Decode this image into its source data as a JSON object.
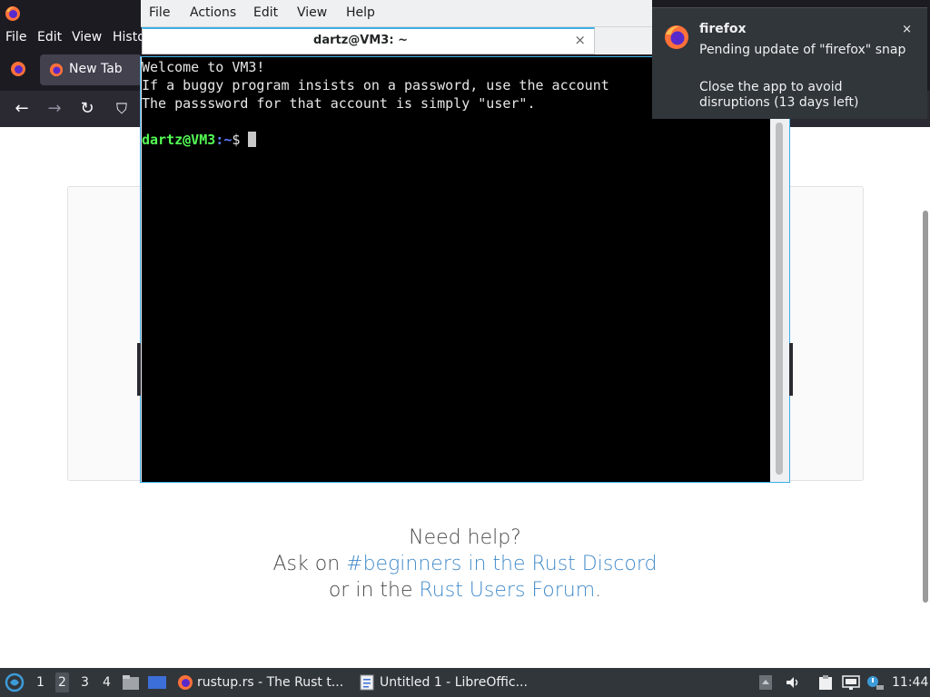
{
  "firefox": {
    "menu": [
      "File",
      "Edit",
      "View",
      "Histo"
    ],
    "tab_label": "New Tab",
    "help": {
      "line1": "Need help?",
      "line2_prefix": "Ask on ",
      "line2_link": "#beginners in the Rust Discord",
      "line3_prefix": "or in the ",
      "line3_link": "Rust Users Forum",
      "line3_suffix": "."
    }
  },
  "terminal": {
    "menu": [
      "File",
      "Actions",
      "Edit",
      "View",
      "Help"
    ],
    "tab_title": "dartz@VM3: ~",
    "lines": [
      "Welcome to VM3!",
      "If a buggy program insists on a password, use the account",
      "The passsword for that account is simply \"user\"."
    ],
    "prompt_user": "dartz@VM3",
    "prompt_sep": ":",
    "prompt_path": "~",
    "prompt_symbol": "$"
  },
  "notification": {
    "app": "firefox",
    "body1": "Pending update of \"firefox\" snap",
    "body2": "Close the app to avoid disruptions (13 days left)",
    "close": "×"
  },
  "taskbar": {
    "workspaces": [
      "1",
      "2",
      "3",
      "4"
    ],
    "active_workspace": "2",
    "tasks": [
      {
        "label": "rustup.rs - The Rust t...",
        "icon": "firefox-icon"
      },
      {
        "label": "Untitled 1 - LibreOffic...",
        "icon": "writer-document-icon"
      }
    ],
    "clock": "11:44"
  },
  "colors": {
    "accent": "#3daee9",
    "link": "#428bca",
    "prompt_user": "#54ff54",
    "prompt_path": "#5c7cff"
  }
}
